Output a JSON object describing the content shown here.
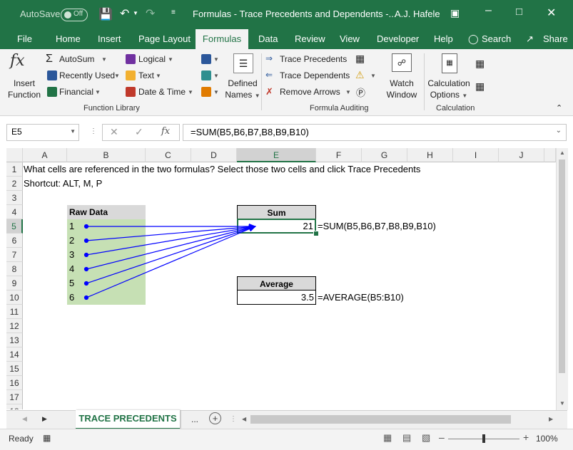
{
  "titlebar": {
    "autosave_label": "AutoSave",
    "autosave_state": "Off",
    "doc_title": "Formulas - Trace Precedents and Dependents  -...",
    "user": "A.J. Hafele"
  },
  "menu": {
    "items": [
      "File",
      "Home",
      "Insert",
      "Page Layout",
      "Formulas",
      "Data",
      "Review",
      "View",
      "Developer",
      "Help"
    ],
    "active": "Formulas",
    "search": "Search",
    "share": "Share"
  },
  "ribbon": {
    "insert_function": [
      "Insert",
      "Function"
    ],
    "autosum": "AutoSum",
    "recently_used": "Recently Used",
    "financial": "Financial",
    "logical": "Logical",
    "text": "Text",
    "date_time": "Date & Time",
    "defined_names": [
      "Defined",
      "Names"
    ],
    "function_library_label": "Function Library",
    "trace_precedents": "Trace Precedents",
    "trace_dependents": "Trace Dependents",
    "remove_arrows": "Remove Arrows",
    "watch_window": [
      "Watch",
      "Window"
    ],
    "formula_auditing_label": "Formula Auditing",
    "calculation_options": [
      "Calculation",
      "Options"
    ],
    "calculation_label": "Calculation"
  },
  "formula_bar": {
    "name_box": "E5",
    "formula": "=SUM(B5,B6,B7,B8,B9,B10)"
  },
  "columns": [
    "A",
    "B",
    "C",
    "D",
    "E",
    "F",
    "G",
    "H",
    "I",
    "J"
  ],
  "rows": [
    "1",
    "2",
    "3",
    "4",
    "5",
    "6",
    "7",
    "8",
    "9",
    "10",
    "11",
    "12",
    "13",
    "14",
    "15",
    "16",
    "17",
    "18"
  ],
  "cells": {
    "a1": "What cells are referenced in the two formulas? Select those two cells and click Trace Precedents",
    "a2": "Shortcut: ALT, M, P",
    "b4": "Raw Data",
    "raw_values": [
      "1",
      "2",
      "3",
      "4",
      "5",
      "6"
    ],
    "e4": "Sum",
    "e5": "21",
    "f5": "=SUM(B5,B6,B7,B8,B9,B10)",
    "e9": "Average",
    "e10": "3.5",
    "f10": "=AVERAGE(B5:B10)"
  },
  "sheet_tab": "TRACE PRECEDENTS",
  "tab_more": "...",
  "status": {
    "ready": "Ready",
    "zoom": "100%"
  },
  "colors": {
    "excel_green": "#217346",
    "raw_fill": "#c6e0b4",
    "arrow_blue": "#0000ff"
  }
}
